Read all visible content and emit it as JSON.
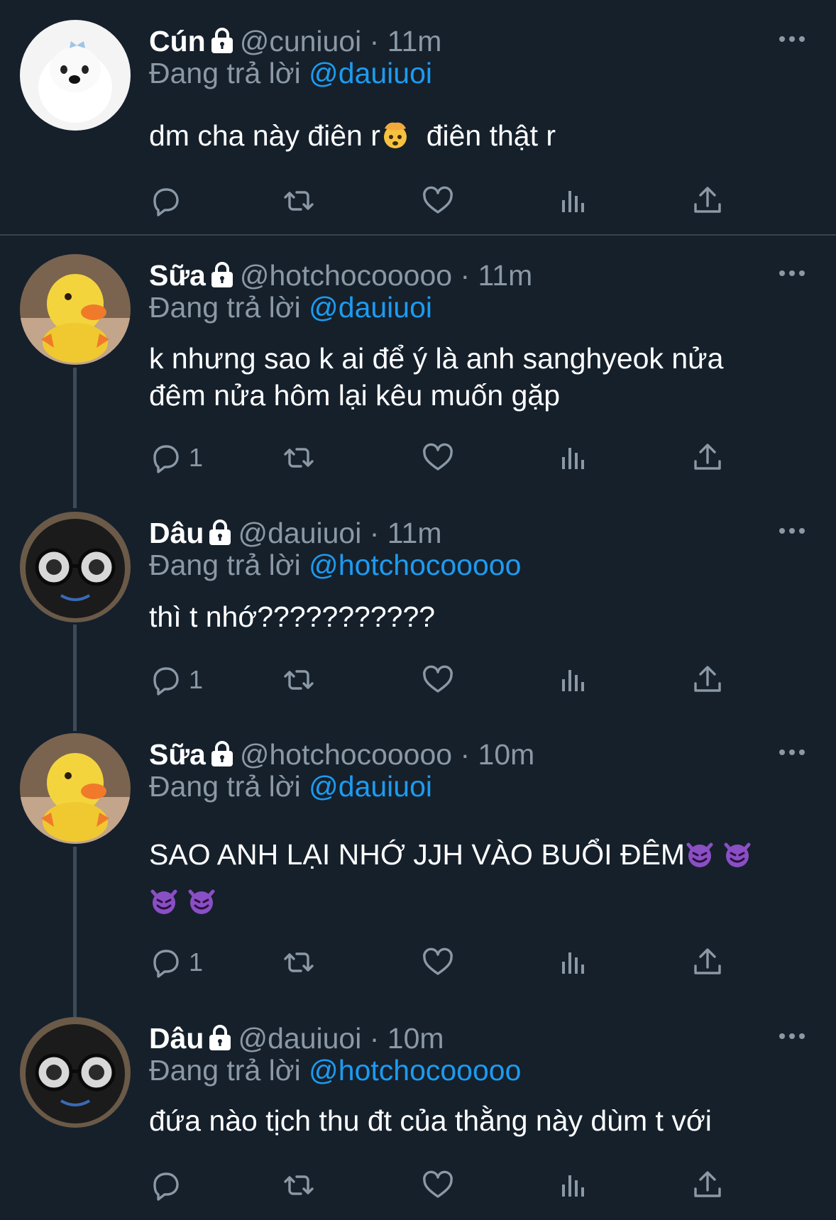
{
  "tweets": [
    {
      "name": "Cún",
      "handle": "@cuniuoi",
      "time": "11m",
      "reply_prefix": "Đang trả lời",
      "reply_to": "@dauiuoi",
      "text_a": "dm cha này điên r",
      "emoji": "exploding-head-emoji",
      "text_b": "  điên thật r",
      "reply_count": "",
      "avatar": "white-puppy-avatar"
    },
    {
      "name": "Sữa",
      "handle": "@hotchocooooo",
      "time": "11m",
      "reply_prefix": "Đang trả lời",
      "reply_to": "@dauiuoi",
      "text_line1": "k nhưng sao k ai để ý là anh sanghyeok nửa",
      "text_line2": "đêm nửa hôm lại kêu muốn gặp",
      "reply_count": "1",
      "avatar": "yellow-duck-avatar"
    },
    {
      "name": "Dâu",
      "handle": "@dauiuoi",
      "time": "11m",
      "reply_prefix": "Đang trả lời",
      "reply_to": "@hotchocooooo",
      "text": "thì t nhớ???????????",
      "reply_count": "1",
      "avatar": "black-plush-glasses-avatar"
    },
    {
      "name": "Sữa",
      "handle": "@hotchocooooo",
      "time": "10m",
      "reply_prefix": "Đang trả lời",
      "reply_to": "@dauiuoi",
      "text": "SAO ANH LẠI NHỚ JJH VÀO BUỔI ĐÊM",
      "emoji": "smiling-devil-emoji",
      "reply_count": "1",
      "avatar": "yellow-duck-avatar"
    },
    {
      "name": "Dâu",
      "handle": "@dauiuoi",
      "time": "10m",
      "reply_prefix": "Đang trả lời",
      "reply_to": "@hotchocooooo",
      "text": "đứa nào tịch thu đt của thằng này dùm t với",
      "reply_count": "",
      "avatar": "black-plush-glasses-avatar"
    }
  ],
  "colors": {
    "background": "#15202b",
    "mention": "#1d9bf0",
    "secondary_text": "#8b98a5",
    "divider": "#38444d"
  }
}
